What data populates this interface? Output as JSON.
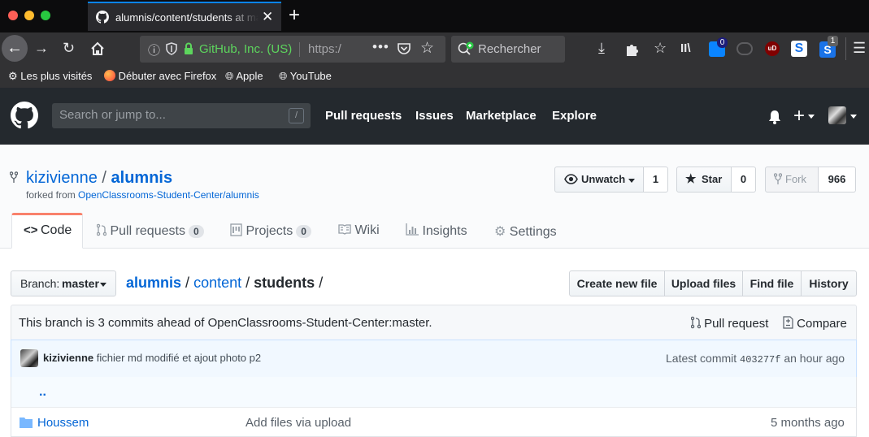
{
  "browser": {
    "tab_title": "alumnis/content/students at ma",
    "url_identity": "GitHub, Inc. (US)",
    "url_text": "https:/",
    "search_placeholder": "Rechercher",
    "bookmarks": [
      "Les plus visités",
      "Débuter avec Firefox",
      "Apple",
      "YouTube"
    ],
    "badge_counts": [
      "0",
      "1"
    ]
  },
  "github": {
    "search_placeholder": "Search or jump to...",
    "search_hotkey": "/",
    "nav": [
      "Pull requests",
      "Issues",
      "Marketplace",
      "Explore"
    ]
  },
  "repo": {
    "owner": "kizivienne",
    "separator": "/",
    "name": "alumnis",
    "forked_from_label": "forked from",
    "forked_from": "OpenClassrooms-Student-Center/alumnis",
    "watch_label": "Unwatch",
    "watch_count": "1",
    "star_label": "Star",
    "star_count": "0",
    "fork_label": "Fork",
    "fork_count": "966",
    "tabs": [
      {
        "label": "Code"
      },
      {
        "label": "Pull requests",
        "count": "0"
      },
      {
        "label": "Projects",
        "count": "0"
      },
      {
        "label": "Wiki"
      },
      {
        "label": "Insights"
      },
      {
        "label": "Settings"
      }
    ]
  },
  "main": {
    "branch_label": "Branch:",
    "branch_name": "master",
    "breadcrumb": {
      "root": "alumnis",
      "sep1": "/",
      "dir": "content",
      "sep2": "/",
      "current": "students",
      "sep3": "/"
    },
    "file_buttons": [
      "Create new file",
      "Upload files",
      "Find file",
      "History"
    ],
    "branch_info": "This branch is 3 commits ahead of OpenClassrooms-Student-Center:master.",
    "pull_request_label": "Pull request",
    "compare_label": "Compare",
    "commit": {
      "author": "kizivienne",
      "message": "fichier md modifié et ajout photo p2",
      "latest_label": "Latest commit",
      "sha": "403277f",
      "time": "an hour ago"
    },
    "parent_dir": "..",
    "files": [
      {
        "name": "Houssem",
        "message": "Add files via upload",
        "age": "5 months ago"
      }
    ]
  },
  "colors": {
    "link": "#0366d6",
    "gh_header": "#24292e",
    "tab_accent": "#f9826c",
    "url_identity": "#5dd55d"
  }
}
